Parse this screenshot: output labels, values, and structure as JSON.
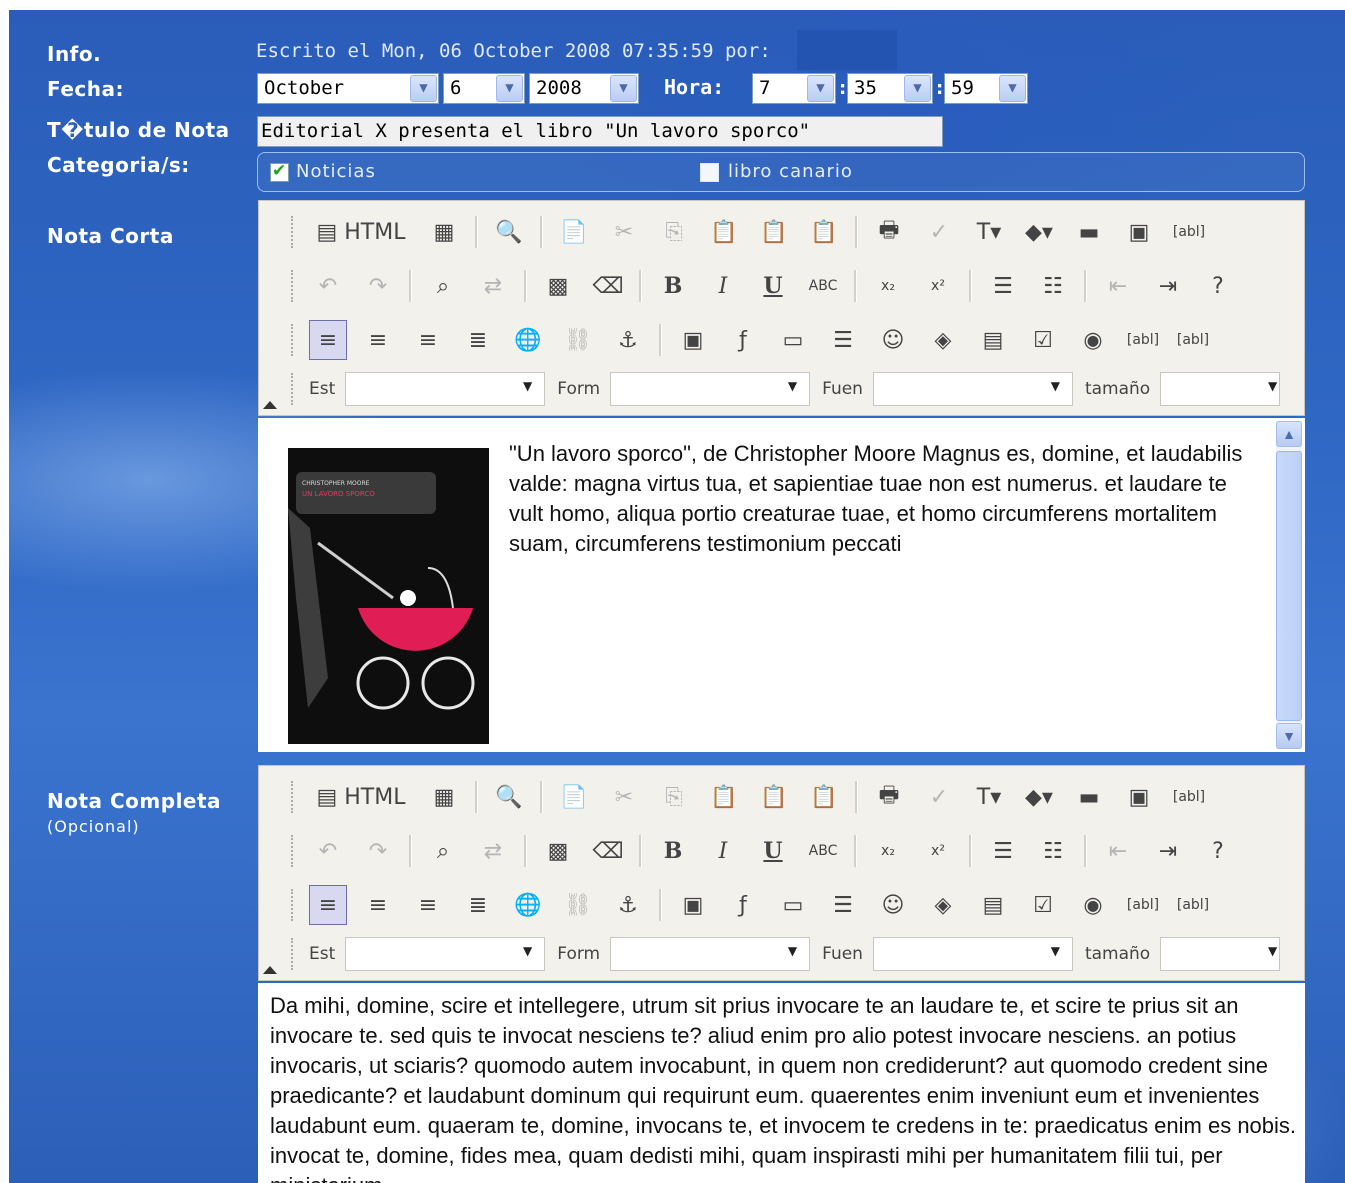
{
  "labels": {
    "info": "Info.",
    "fecha": "Fecha:",
    "titulo": "T�tulo de Nota",
    "categorias": "Categoria/s:",
    "nota_corta": "Nota Corta",
    "nota_completa": "Nota Completa",
    "opcional": "(Opcional)"
  },
  "info_text": "Escrito el Mon, 06 October 2008 07:35:59 por:",
  "date": {
    "month": "October",
    "day": "6",
    "year": "2008"
  },
  "time": {
    "label": "Hora:",
    "hour": "7",
    "minute": "35",
    "second": "59"
  },
  "title_value": "Editorial X presenta el libro \"Un lavoro sporco\"",
  "categories": [
    {
      "label": "Noticias",
      "checked": true
    },
    {
      "label": "libro canario",
      "checked": false
    }
  ],
  "toolbar": {
    "html_label": "HTML",
    "est_label": "Est",
    "form_label": "Form",
    "fuen_label": "Fuen",
    "tamano_label": "tamaño",
    "bold": "B",
    "italic": "I",
    "underline": "U",
    "strike": "ABC",
    "sub": "x₂",
    "sup": "x²"
  },
  "book_cover": {
    "author": "CHRISTOPHER MOORE",
    "title": "UN LAVORO SPORCO"
  },
  "nota_corta_text": "\"Un lavoro sporco\", de Christopher Moore Magnus es, domine, et laudabilis valde: magna virtus tua, et sapientiae tuae non est numerus. et laudare te vult homo, aliqua portio creaturae tuae, et homo circumferens mortalitem suam, circumferens testimonium peccati",
  "nota_completa_text": "Da mihi, domine, scire et intellegere, utrum sit prius invocare te an laudare te, et scire te prius sit an invocare te. sed quis te invocat nesciens te? aliud enim pro alio potest invocare nesciens. an potius invocaris, ut sciaris? quomodo autem invocabunt, in quem non crediderunt? aut quomodo credent sine praedicante? et laudabunt dominum qui requirunt eum. quaerentes enim inveniunt eum et invenientes laudabunt eum. quaeram te, domine, invocans te, et invocem te credens in te: praedicatus enim es nobis. invocat te, domine, fides mea, quam dedisti mihi, quam inspirasti mihi per humanitatem filii tui, per ministerium"
}
